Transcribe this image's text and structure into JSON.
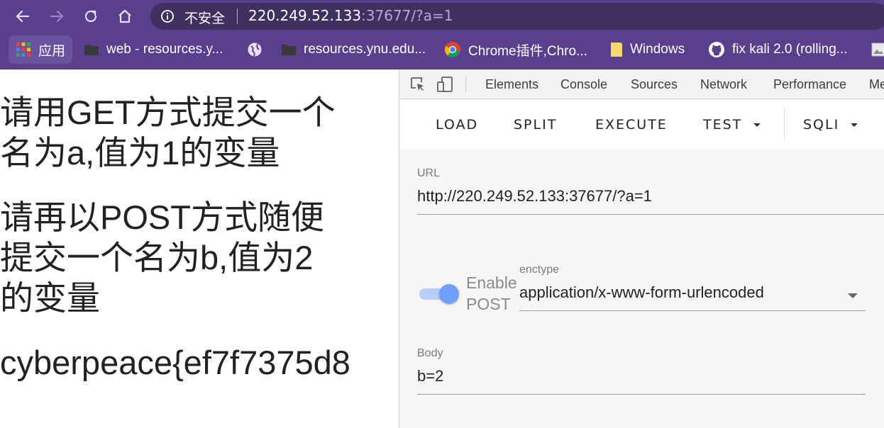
{
  "browser": {
    "address": {
      "security_label": "不安全",
      "url_host": "220.249.52.133",
      "url_rest": ":37677/?a=1"
    },
    "bookmarks": [
      {
        "icon": "apps-grid-icon",
        "label": "应用"
      },
      {
        "icon": "folder-icon",
        "label": "web - resources.y..."
      },
      {
        "icon": "globe-icon",
        "label": ""
      },
      {
        "icon": "folder-icon",
        "label": "resources.ynu.edu..."
      },
      {
        "icon": "chrome-icon",
        "label": "Chrome插件,Chro..."
      },
      {
        "icon": "bookmark-icon",
        "label": "Windows"
      },
      {
        "icon": "github-icon",
        "label": "fix kali 2.0 (rolling..."
      }
    ]
  },
  "page": {
    "line1": "请用GET方式提交一个",
    "line2": "名为a,值为1的变量",
    "line3": "请再以POST方式随便",
    "line4": "提交一个名为b,值为2",
    "line5": "的变量",
    "flag": "cyberpeace{ef7f7375d8"
  },
  "devtools": {
    "tabs": [
      "Elements",
      "Console",
      "Sources",
      "Network",
      "Performance",
      "Me"
    ],
    "toolbar": {
      "load": "LOAD",
      "split": "SPLIT",
      "execute": "EXECUTE",
      "test": "TEST",
      "sqli": "SQLI"
    },
    "url_label": "URL",
    "url_value": "http://220.249.52.133:37677/?a=1",
    "enable_post_line1": "Enable",
    "enable_post_line2": "POST",
    "enable_post_on": true,
    "enctype_label": "enctype",
    "enctype_value": "application/x-www-form-urlencoded",
    "body_label": "Body",
    "body_value": "b=2"
  }
}
